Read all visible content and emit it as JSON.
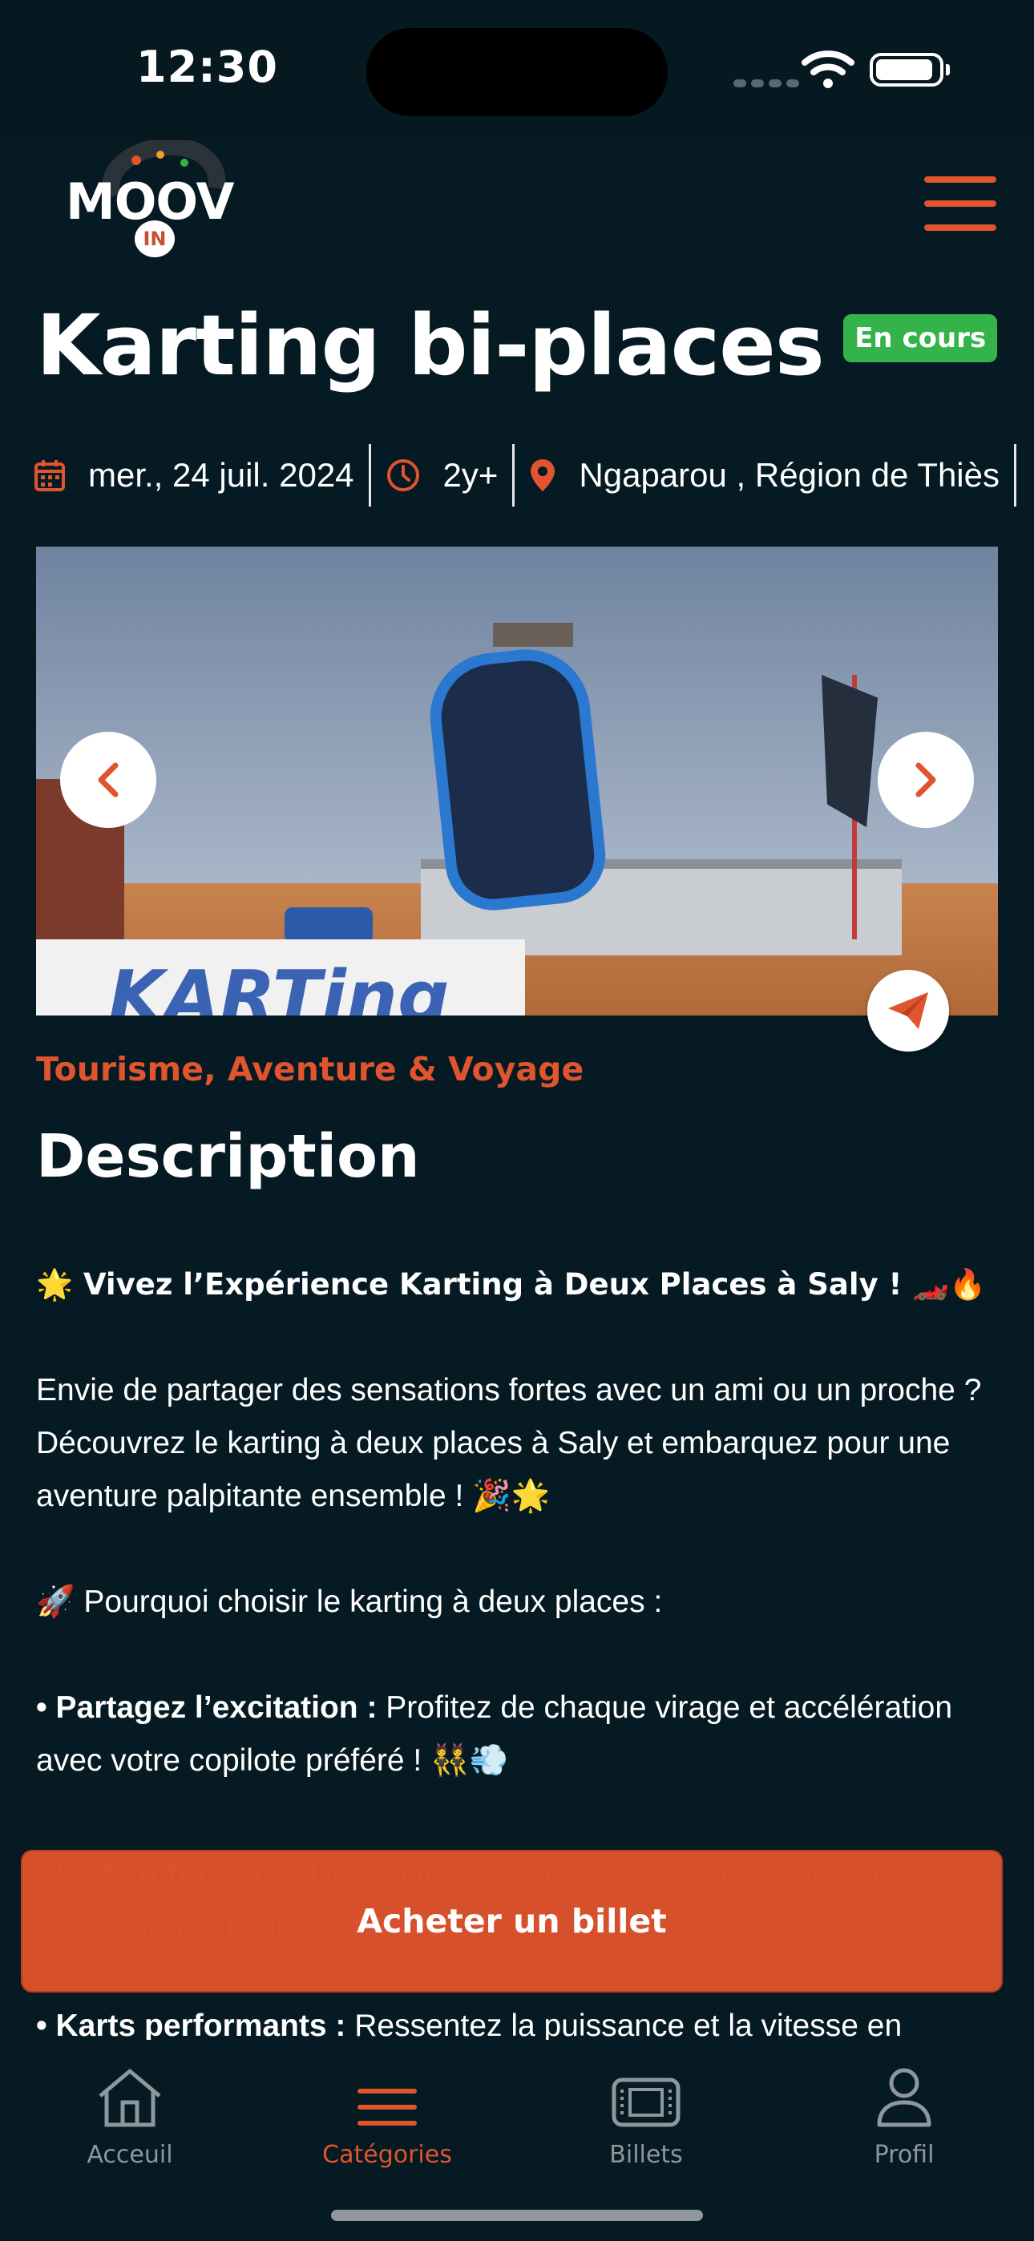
{
  "status_bar": {
    "time": "12:30"
  },
  "header": {
    "logo_text": "MOOV",
    "logo_badge": "IN"
  },
  "event": {
    "title": "Karting bi-places",
    "status": "En cours",
    "date": "mer., 24 juil. 2024",
    "age": "2y+",
    "location": "Ngaparou , Région de Thiès",
    "category": "Tourisme, Aventure & Voyage",
    "image_wall_text": "KARTing"
  },
  "description": {
    "heading": "Description",
    "lead": "🌟 Vivez l’Expérience Karting à Deux Places à Saly ! 🏎️🔥",
    "intro": "Envie de partager des sensations fortes avec un ami ou un proche ? Découvrez le karting à deux places à Saly et embarquez pour une aventure palpitante ensemble ! 🎉🌟",
    "why": "🚀 Pourquoi choisir le karting à deux places :",
    "points": [
      {
        "bold": "Partagez l’excitation :",
        "text": " Profitez de chaque virage et accélération avec votre copilote préféré ! 👯💨"
      },
      {
        "bold": "Piste ultra-cool :",
        "text": " Des courses palpitantes sur une piste conçue pour le fun et l’adrénaline !"
      },
      {
        "bold": "Karts performants :",
        "text": " Ressentez la puissance et la vitesse en"
      }
    ],
    "bullet": "•"
  },
  "cta": {
    "buy_label": "Acheter un billet"
  },
  "tabs": [
    {
      "label": "Acceuil",
      "icon": "home-icon",
      "active": false
    },
    {
      "label": "Catégories",
      "icon": "menu-icon",
      "active": true
    },
    {
      "label": "Billets",
      "icon": "ticket-icon",
      "active": false
    },
    {
      "label": "Profil",
      "icon": "user-icon",
      "active": false
    }
  ],
  "colors": {
    "accent": "#e0542e",
    "background": "#051a22",
    "badge": "#34b34a"
  }
}
